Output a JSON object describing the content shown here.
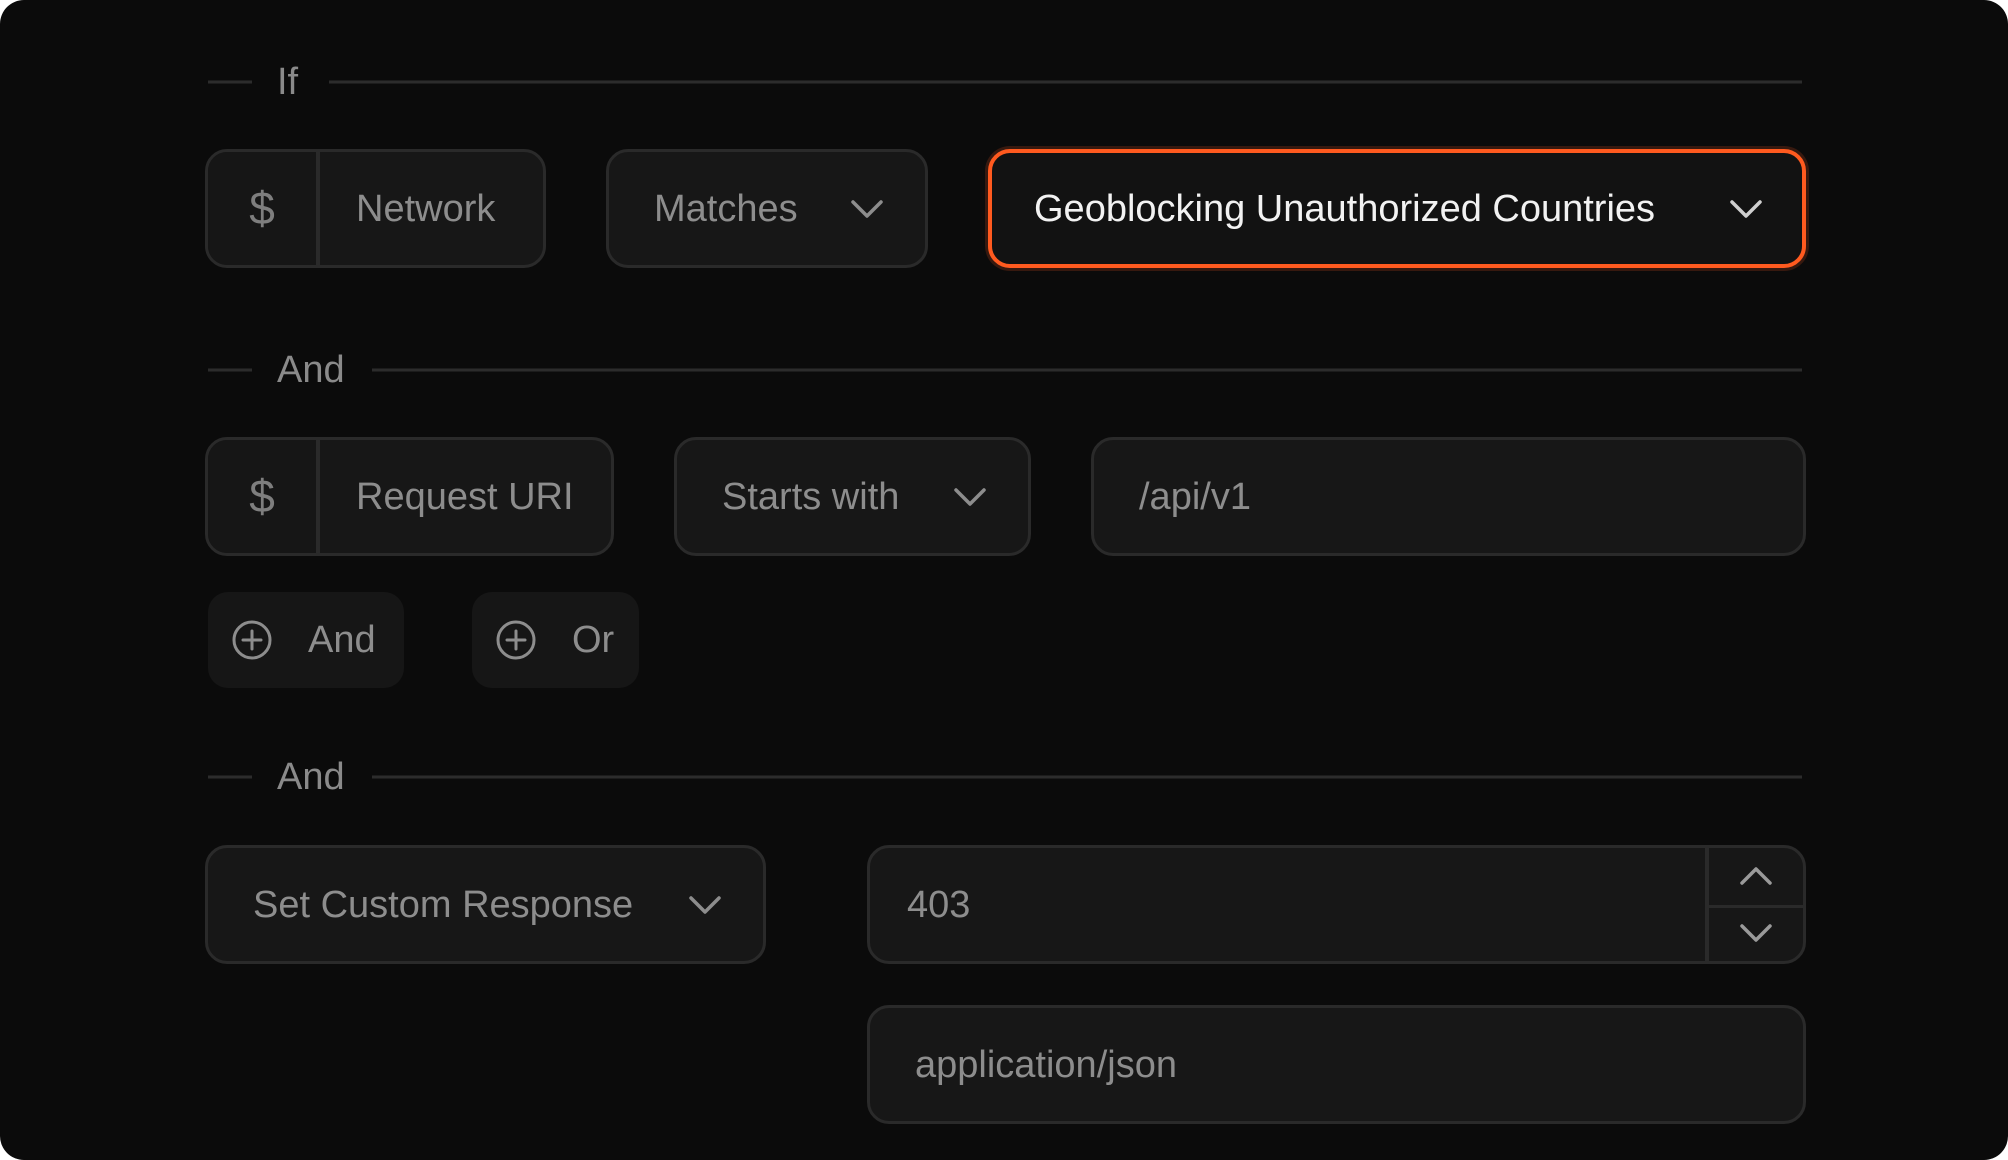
{
  "sections": {
    "if_label": "If",
    "and_label_1": "And",
    "and_label_2": "And"
  },
  "condition_1": {
    "variable_symbol": "$",
    "variable": "Network",
    "operator": "Matches",
    "value": "Geoblocking Unauthorized Countries"
  },
  "condition_2": {
    "variable_symbol": "$",
    "variable": "Request URI",
    "operator": "Starts with",
    "value": "/api/v1"
  },
  "add_buttons": {
    "and": "And",
    "or": "Or"
  },
  "action": {
    "type": "Set Custom Response",
    "status_code": "403",
    "content_type": "application/json"
  },
  "colors": {
    "background": "#0b0b0b",
    "field": "#171717",
    "border": "#2a2a2a",
    "accent": "#ff5a1f",
    "muted_text": "#8d8d8d"
  },
  "icons": {
    "dropdown": "chevron-down-icon",
    "add": "plus-circle-icon",
    "increment": "chevron-up-icon",
    "decrement": "chevron-down-icon"
  }
}
